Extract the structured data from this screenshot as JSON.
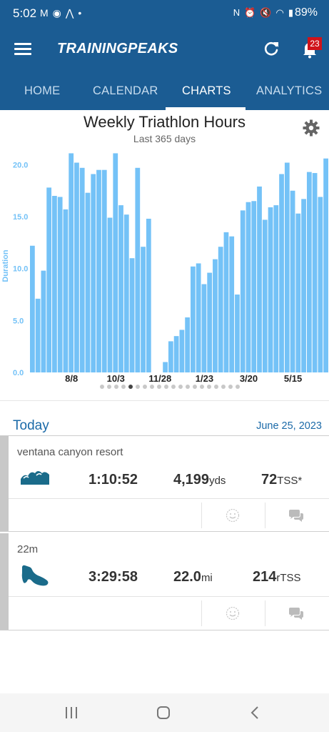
{
  "status_bar": {
    "time": "5:02",
    "left_icons": [
      "gmail-icon",
      "messenger-icon",
      "strava-icon",
      "dot-icon"
    ],
    "right_icons": [
      "nfc-icon",
      "alarm-icon",
      "mute-icon",
      "wifi-icon",
      "signal-icon"
    ],
    "battery": "89%"
  },
  "header": {
    "logo": "TRAININGPEAKS",
    "notification_count": "23"
  },
  "tabs": [
    {
      "label": "HOME",
      "active": false
    },
    {
      "label": "CALENDAR",
      "active": false
    },
    {
      "label": "CHARTS",
      "active": true
    },
    {
      "label": "ANALYTICS",
      "active": false
    }
  ],
  "chart": {
    "title": "Weekly Triathlon Hours",
    "subtitle": "Last 365 days",
    "pager": {
      "total": 20,
      "active_index": 4
    }
  },
  "chart_data": {
    "type": "bar",
    "title": "Weekly Triathlon Hours",
    "subtitle": "Last 365 days",
    "ylabel": "Duration",
    "xlabel": "",
    "ylim": [
      0,
      21.2
    ],
    "yticks": [
      "0.0",
      "5.0",
      "10.0",
      "15.0",
      "20.0"
    ],
    "xtick_labels": [
      "8/8",
      "10/3",
      "11/28",
      "1/23",
      "3/20",
      "5/15"
    ],
    "xtick_week_index": [
      7,
      15,
      23,
      31,
      39,
      47
    ],
    "bar_color": "#74c2f7",
    "values": [
      12.2,
      7.1,
      9.8,
      17.8,
      17.0,
      16.9,
      15.7,
      21.1,
      20.2,
      19.7,
      17.3,
      19.1,
      19.5,
      19.5,
      14.9,
      21.1,
      16.1,
      15.2,
      11.0,
      19.7,
      12.1,
      14.8,
      0,
      0,
      1.0,
      3.0,
      3.5,
      4.1,
      5.3,
      10.2,
      10.5,
      8.5,
      9.6,
      10.9,
      12.1,
      13.5,
      13.1,
      7.5,
      15.6,
      16.4,
      16.5,
      17.9,
      14.7,
      15.9,
      16.1,
      19.1,
      20.2,
      17.5,
      15.3,
      16.7,
      19.3,
      19.2,
      16.9,
      20.6
    ]
  },
  "today": {
    "label": "Today",
    "date": "June 25, 2023"
  },
  "workouts": [
    {
      "title": "ventana canyon resort",
      "icon": "swim-icon",
      "duration": "1:10:52",
      "distance_value": "4,199",
      "distance_unit": "yds",
      "tss_value": "72",
      "tss_unit": "TSS*"
    },
    {
      "title": "22m",
      "icon": "run-icon",
      "duration": "3:29:58",
      "distance_value": "22.0",
      "distance_unit": "mi",
      "tss_value": "214",
      "tss_unit": "rTSS"
    }
  ],
  "colors": {
    "primary": "#1b5c93",
    "accent_text": "#1b6aa8",
    "bar": "#74c2f7",
    "axis_label": "#74c2f7",
    "icon_teal": "#1a6b8a",
    "badge": "#d0131a"
  }
}
